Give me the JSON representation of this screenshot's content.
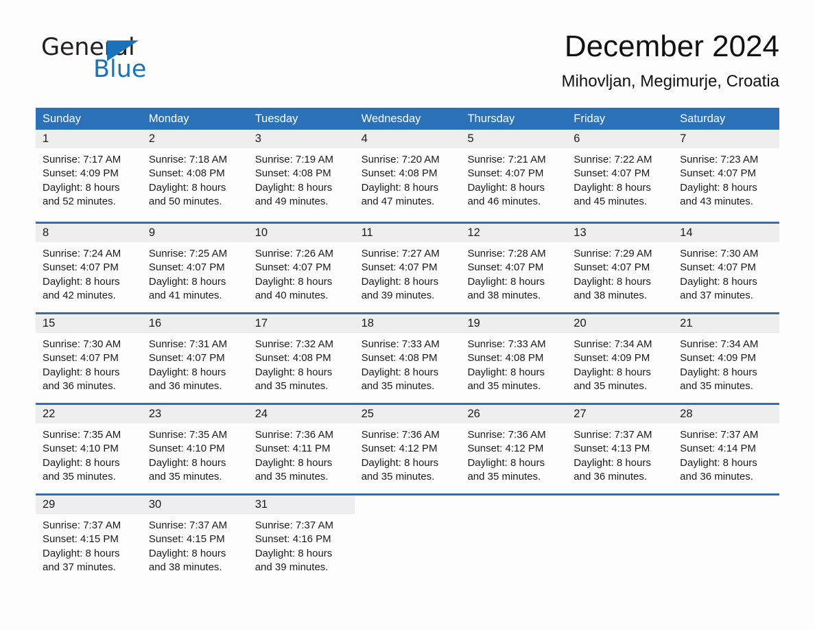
{
  "brand": {
    "name_part1": "General",
    "name_part2": "Blue",
    "triangle_color": "#1a72ba"
  },
  "header": {
    "title": "December 2024",
    "subtitle": "Mihovljan, Megimurje, Croatia"
  },
  "theme": {
    "header_blue": "#2b71b8",
    "day_band_gray": "#eeeeee",
    "page_background": "#fdfdfd",
    "text_color": "#1a1a1a"
  },
  "weekdays": [
    "Sunday",
    "Monday",
    "Tuesday",
    "Wednesday",
    "Thursday",
    "Friday",
    "Saturday"
  ],
  "weeks": [
    [
      {
        "day": "1",
        "sunrise": "Sunrise: 7:17 AM",
        "sunset": "Sunset: 4:09 PM",
        "daylight1": "Daylight: 8 hours",
        "daylight2": "and 52 minutes."
      },
      {
        "day": "2",
        "sunrise": "Sunrise: 7:18 AM",
        "sunset": "Sunset: 4:08 PM",
        "daylight1": "Daylight: 8 hours",
        "daylight2": "and 50 minutes."
      },
      {
        "day": "3",
        "sunrise": "Sunrise: 7:19 AM",
        "sunset": "Sunset: 4:08 PM",
        "daylight1": "Daylight: 8 hours",
        "daylight2": "and 49 minutes."
      },
      {
        "day": "4",
        "sunrise": "Sunrise: 7:20 AM",
        "sunset": "Sunset: 4:08 PM",
        "daylight1": "Daylight: 8 hours",
        "daylight2": "and 47 minutes."
      },
      {
        "day": "5",
        "sunrise": "Sunrise: 7:21 AM",
        "sunset": "Sunset: 4:07 PM",
        "daylight1": "Daylight: 8 hours",
        "daylight2": "and 46 minutes."
      },
      {
        "day": "6",
        "sunrise": "Sunrise: 7:22 AM",
        "sunset": "Sunset: 4:07 PM",
        "daylight1": "Daylight: 8 hours",
        "daylight2": "and 45 minutes."
      },
      {
        "day": "7",
        "sunrise": "Sunrise: 7:23 AM",
        "sunset": "Sunset: 4:07 PM",
        "daylight1": "Daylight: 8 hours",
        "daylight2": "and 43 minutes."
      }
    ],
    [
      {
        "day": "8",
        "sunrise": "Sunrise: 7:24 AM",
        "sunset": "Sunset: 4:07 PM",
        "daylight1": "Daylight: 8 hours",
        "daylight2": "and 42 minutes."
      },
      {
        "day": "9",
        "sunrise": "Sunrise: 7:25 AM",
        "sunset": "Sunset: 4:07 PM",
        "daylight1": "Daylight: 8 hours",
        "daylight2": "and 41 minutes."
      },
      {
        "day": "10",
        "sunrise": "Sunrise: 7:26 AM",
        "sunset": "Sunset: 4:07 PM",
        "daylight1": "Daylight: 8 hours",
        "daylight2": "and 40 minutes."
      },
      {
        "day": "11",
        "sunrise": "Sunrise: 7:27 AM",
        "sunset": "Sunset: 4:07 PM",
        "daylight1": "Daylight: 8 hours",
        "daylight2": "and 39 minutes."
      },
      {
        "day": "12",
        "sunrise": "Sunrise: 7:28 AM",
        "sunset": "Sunset: 4:07 PM",
        "daylight1": "Daylight: 8 hours",
        "daylight2": "and 38 minutes."
      },
      {
        "day": "13",
        "sunrise": "Sunrise: 7:29 AM",
        "sunset": "Sunset: 4:07 PM",
        "daylight1": "Daylight: 8 hours",
        "daylight2": "and 38 minutes."
      },
      {
        "day": "14",
        "sunrise": "Sunrise: 7:30 AM",
        "sunset": "Sunset: 4:07 PM",
        "daylight1": "Daylight: 8 hours",
        "daylight2": "and 37 minutes."
      }
    ],
    [
      {
        "day": "15",
        "sunrise": "Sunrise: 7:30 AM",
        "sunset": "Sunset: 4:07 PM",
        "daylight1": "Daylight: 8 hours",
        "daylight2": "and 36 minutes."
      },
      {
        "day": "16",
        "sunrise": "Sunrise: 7:31 AM",
        "sunset": "Sunset: 4:07 PM",
        "daylight1": "Daylight: 8 hours",
        "daylight2": "and 36 minutes."
      },
      {
        "day": "17",
        "sunrise": "Sunrise: 7:32 AM",
        "sunset": "Sunset: 4:08 PM",
        "daylight1": "Daylight: 8 hours",
        "daylight2": "and 35 minutes."
      },
      {
        "day": "18",
        "sunrise": "Sunrise: 7:33 AM",
        "sunset": "Sunset: 4:08 PM",
        "daylight1": "Daylight: 8 hours",
        "daylight2": "and 35 minutes."
      },
      {
        "day": "19",
        "sunrise": "Sunrise: 7:33 AM",
        "sunset": "Sunset: 4:08 PM",
        "daylight1": "Daylight: 8 hours",
        "daylight2": "and 35 minutes."
      },
      {
        "day": "20",
        "sunrise": "Sunrise: 7:34 AM",
        "sunset": "Sunset: 4:09 PM",
        "daylight1": "Daylight: 8 hours",
        "daylight2": "and 35 minutes."
      },
      {
        "day": "21",
        "sunrise": "Sunrise: 7:34 AM",
        "sunset": "Sunset: 4:09 PM",
        "daylight1": "Daylight: 8 hours",
        "daylight2": "and 35 minutes."
      }
    ],
    [
      {
        "day": "22",
        "sunrise": "Sunrise: 7:35 AM",
        "sunset": "Sunset: 4:10 PM",
        "daylight1": "Daylight: 8 hours",
        "daylight2": "and 35 minutes."
      },
      {
        "day": "23",
        "sunrise": "Sunrise: 7:35 AM",
        "sunset": "Sunset: 4:10 PM",
        "daylight1": "Daylight: 8 hours",
        "daylight2": "and 35 minutes."
      },
      {
        "day": "24",
        "sunrise": "Sunrise: 7:36 AM",
        "sunset": "Sunset: 4:11 PM",
        "daylight1": "Daylight: 8 hours",
        "daylight2": "and 35 minutes."
      },
      {
        "day": "25",
        "sunrise": "Sunrise: 7:36 AM",
        "sunset": "Sunset: 4:12 PM",
        "daylight1": "Daylight: 8 hours",
        "daylight2": "and 35 minutes."
      },
      {
        "day": "26",
        "sunrise": "Sunrise: 7:36 AM",
        "sunset": "Sunset: 4:12 PM",
        "daylight1": "Daylight: 8 hours",
        "daylight2": "and 35 minutes."
      },
      {
        "day": "27",
        "sunrise": "Sunrise: 7:37 AM",
        "sunset": "Sunset: 4:13 PM",
        "daylight1": "Daylight: 8 hours",
        "daylight2": "and 36 minutes."
      },
      {
        "day": "28",
        "sunrise": "Sunrise: 7:37 AM",
        "sunset": "Sunset: 4:14 PM",
        "daylight1": "Daylight: 8 hours",
        "daylight2": "and 36 minutes."
      }
    ],
    [
      {
        "day": "29",
        "sunrise": "Sunrise: 7:37 AM",
        "sunset": "Sunset: 4:15 PM",
        "daylight1": "Daylight: 8 hours",
        "daylight2": "and 37 minutes."
      },
      {
        "day": "30",
        "sunrise": "Sunrise: 7:37 AM",
        "sunset": "Sunset: 4:15 PM",
        "daylight1": "Daylight: 8 hours",
        "daylight2": "and 38 minutes."
      },
      {
        "day": "31",
        "sunrise": "Sunrise: 7:37 AM",
        "sunset": "Sunset: 4:16 PM",
        "daylight1": "Daylight: 8 hours",
        "daylight2": "and 39 minutes."
      },
      {
        "day": "",
        "sunrise": "",
        "sunset": "",
        "daylight1": "",
        "daylight2": ""
      },
      {
        "day": "",
        "sunrise": "",
        "sunset": "",
        "daylight1": "",
        "daylight2": ""
      },
      {
        "day": "",
        "sunrise": "",
        "sunset": "",
        "daylight1": "",
        "daylight2": ""
      },
      {
        "day": "",
        "sunrise": "",
        "sunset": "",
        "daylight1": "",
        "daylight2": ""
      }
    ]
  ]
}
